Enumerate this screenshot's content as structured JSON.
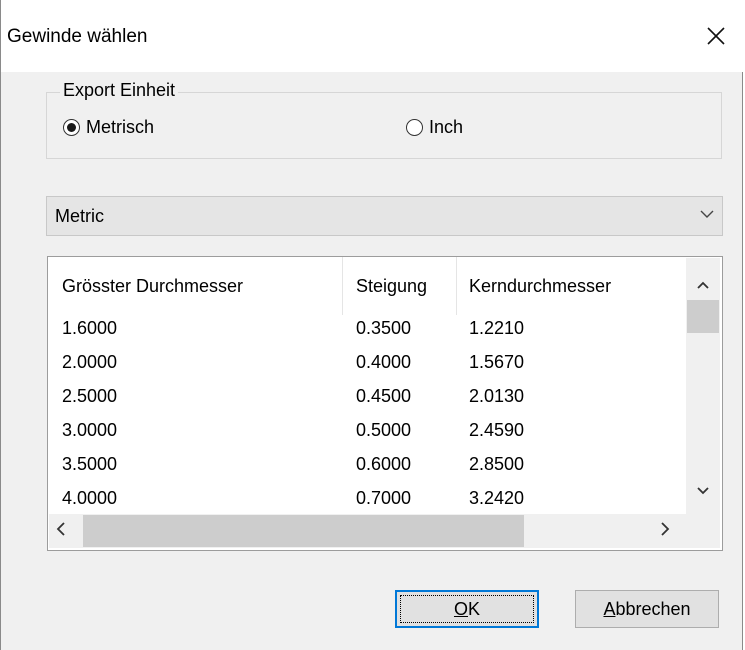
{
  "window": {
    "title": "Gewinde wählen",
    "close_icon": "close-icon"
  },
  "export_unit": {
    "legend": "Export Einheit",
    "options": [
      {
        "label": "Metrisch",
        "selected": true
      },
      {
        "label": "Inch",
        "selected": false
      }
    ]
  },
  "thread_standard": {
    "selected": "Metric",
    "arrow_icon": "chevron-down-icon"
  },
  "thread_table": {
    "columns": [
      "Grösster Durchmesser",
      "Steigung",
      "Kerndurchmesser"
    ],
    "rows": [
      [
        "1.6000",
        "0.3500",
        "1.2210"
      ],
      [
        "2.0000",
        "0.4000",
        "1.5670"
      ],
      [
        "2.5000",
        "0.4500",
        "2.0130"
      ],
      [
        "3.0000",
        "0.5000",
        "2.4590"
      ],
      [
        "3.5000",
        "0.6000",
        "2.8500"
      ],
      [
        "4.0000",
        "0.7000",
        "3.2420"
      ]
    ]
  },
  "buttons": {
    "ok": {
      "mnemonic": "O",
      "rest": "K"
    },
    "cancel": {
      "mnemonic": "A",
      "rest": "bbrechen"
    }
  },
  "colors": {
    "focus_border": "#0078d7",
    "dialog_bg": "#f0f0f0"
  }
}
